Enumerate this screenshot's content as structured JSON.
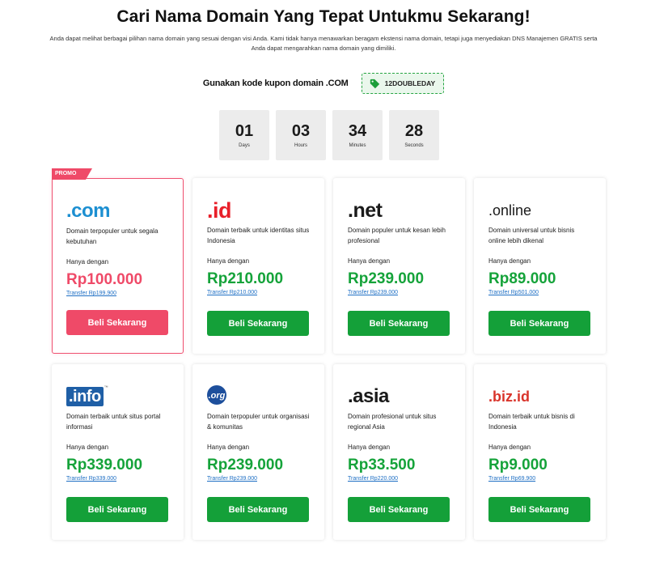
{
  "header": {
    "title": "Cari Nama Domain Yang Tepat Untukmu Sekarang!",
    "subtitle": "Anda dapat melihat berbagai pilihan nama domain yang sesuai dengan visi Anda. Kami tidak hanya menawarkan beragam ekstensi nama domain, tetapi juga menyediakan DNS Manajemen GRATIS serta Anda dapat mengarahkan nama domain yang dimiliki."
  },
  "coupon": {
    "text": "Gunakan kode kupon domain .COM",
    "code": "12DOUBLEDAY",
    "icon": "tag-icon"
  },
  "countdown": [
    {
      "value": "01",
      "label": "Days"
    },
    {
      "value": "03",
      "label": "Hours"
    },
    {
      "value": "34",
      "label": "Minutes"
    },
    {
      "value": "28",
      "label": "Seconds"
    }
  ],
  "colors": {
    "accent_green": "#14a039",
    "accent_red": "#ef4a68",
    "link_blue": "#1e6fc4"
  },
  "promo_badge": "PROMO",
  "price_prefix_label": "Hanya dengan",
  "buy_label": "Beli Sekarang",
  "domains": [
    {
      "ext": ".com",
      "desc": "Domain terpopuler untuk segala kebutuhan",
      "price": "Rp100.000",
      "transfer": "Transfer Rp199.900",
      "promo": true
    },
    {
      "ext": ".id",
      "desc": "Domain terbaik untuk identitas situs Indonesia",
      "price": "Rp210.000",
      "transfer": "Transfer Rp210.000"
    },
    {
      "ext": ".net",
      "desc": "Domain populer untuk kesan lebih profesional",
      "price": "Rp239.000",
      "transfer": "Transfer Rp239.000"
    },
    {
      "ext": ".online",
      "desc": "Domain universal untuk bisnis online lebih dikenal",
      "price": "Rp89.000",
      "transfer": "Transfer Rp501.000"
    },
    {
      "ext": ".info",
      "desc": "Domain terbaik untuk situs portal informasi",
      "price": "Rp339.000",
      "transfer": "Transfer Rp339.000"
    },
    {
      "ext": ".org",
      "desc": "Domain terpopuler untuk organisasi & komunitas",
      "price": "Rp239.000",
      "transfer": "Transfer Rp239.000"
    },
    {
      "ext": ".asia",
      "desc": "Domain profesional untuk situs regional Asia",
      "price": "Rp33.500",
      "transfer": "Transfer Rp220.000"
    },
    {
      "ext": ".biz.id",
      "desc": "Domain terbaik untuk bisnis di Indonesia",
      "price": "Rp9.000",
      "transfer": "Transfer Rp69.900"
    }
  ]
}
